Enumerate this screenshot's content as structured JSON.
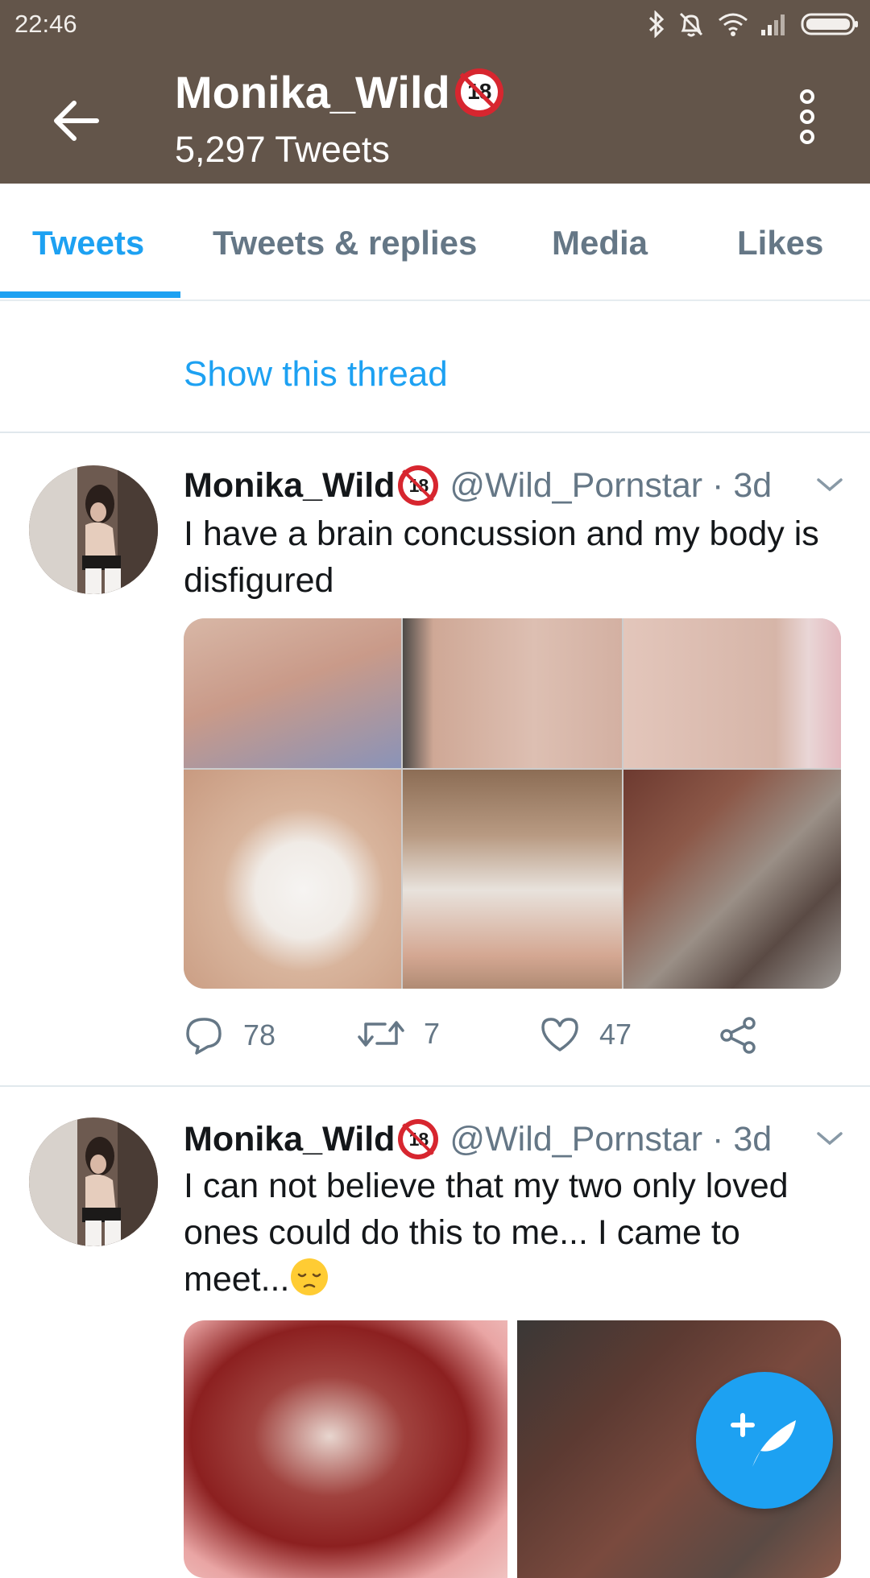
{
  "status_bar": {
    "time": "22:46"
  },
  "profile": {
    "name": "Monika_Wild",
    "badge": "18",
    "tweet_count": "5,297 Tweets"
  },
  "tabs": [
    {
      "label": "Tweets",
      "active": true
    },
    {
      "label": "Tweets & replies",
      "active": false
    },
    {
      "label": "Media",
      "active": false
    },
    {
      "label": "Likes",
      "active": false
    }
  ],
  "feed": {
    "show_thread": "Show this thread",
    "tweets": [
      {
        "name": "Monika_Wild",
        "badge": "18",
        "meta": "@Wild_Pornstar · 3d",
        "text": "I have a brain concussion and my body is disfigured",
        "replies": "78",
        "retweets": "7",
        "likes": "47"
      },
      {
        "name": "Monika_Wild",
        "badge": "18",
        "meta": "@Wild_Pornstar · 3d",
        "text": "I can not believe that my two only loved ones could do this to me... I came to meet..."
      }
    ]
  },
  "colors": {
    "header_bg": "#63554a",
    "accent": "#1da1f2",
    "muted": "#657786"
  },
  "icons": [
    "back-arrow-icon",
    "more-vertical-icon",
    "bluetooth-icon",
    "muted-alarm-icon",
    "wifi-icon",
    "signal-icon",
    "battery-icon",
    "chevron-down-icon",
    "reply-icon",
    "retweet-icon",
    "like-icon",
    "share-icon",
    "compose-icon",
    "pensive-face-emoji"
  ]
}
